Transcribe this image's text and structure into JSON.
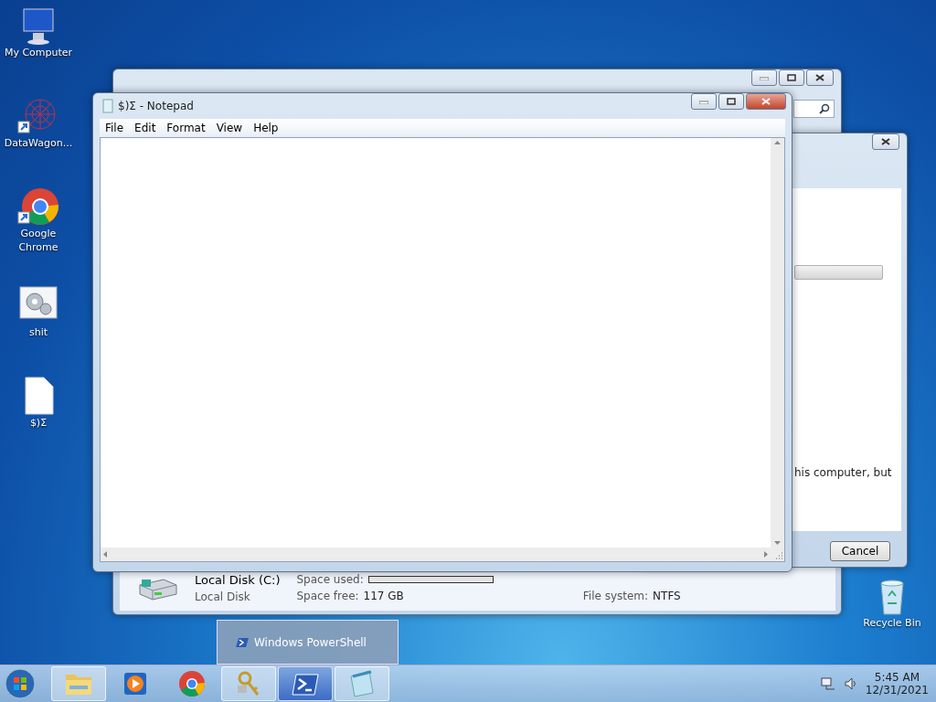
{
  "desktop_icons": [
    {
      "kind": "computer",
      "label": "My Computer",
      "shortcut": false
    },
    {
      "kind": "web",
      "label": "DataWagon...",
      "shortcut": true
    },
    {
      "kind": "chrome",
      "label": "Google Chrome",
      "shortcut": true
    },
    {
      "kind": "settings",
      "label": "shit",
      "shortcut": false
    },
    {
      "kind": "document",
      "label": "$)Σ",
      "shortcut": false
    },
    {
      "kind": "recycle",
      "label": "Recycle Bin",
      "shortcut": false
    }
  ],
  "explorer_window": {
    "details": {
      "drive_name": "Local Disk (C:)",
      "drive_type": "Local Disk",
      "fields": [
        {
          "label": "Space used:"
        },
        {
          "label": "Space free:",
          "value": "117 GB"
        },
        {
          "label": "File system:",
          "value": "NTFS"
        }
      ]
    }
  },
  "dialog": {
    "message": "his computer, but",
    "button": "Cancel"
  },
  "notepad": {
    "title": "$)Σ - Notepad",
    "menu": [
      "File",
      "Edit",
      "Format",
      "View",
      "Help"
    ]
  },
  "taskbar_popup": {
    "label": "Windows PowerShell"
  },
  "taskbar": {
    "items": [
      {
        "kind": "folder",
        "open": true,
        "selected": false
      },
      {
        "kind": "media",
        "open": false,
        "selected": false
      },
      {
        "kind": "chrome",
        "open": false,
        "selected": false
      },
      {
        "kind": "keys",
        "open": true,
        "selected": false
      },
      {
        "kind": "powershell",
        "open": true,
        "selected": true
      },
      {
        "kind": "notepad",
        "open": true,
        "selected": false
      }
    ],
    "time": "5:45 AM",
    "date": "12/31/2021"
  }
}
